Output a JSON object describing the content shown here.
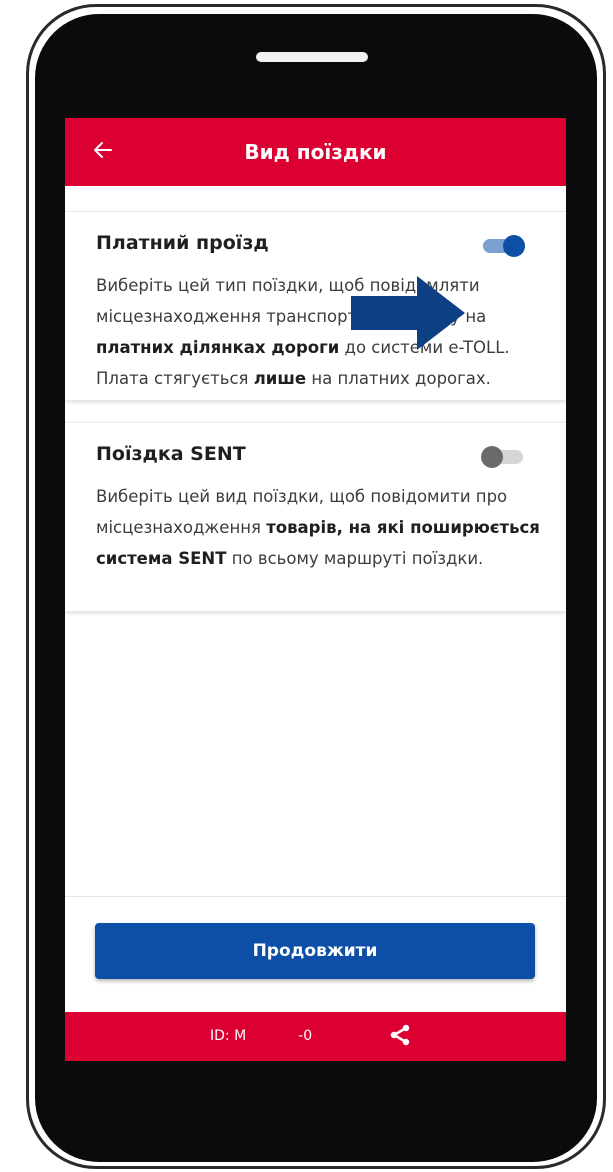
{
  "header": {
    "title": "Вид поїздки"
  },
  "cards": [
    {
      "title": "Платний проїзд",
      "toggle": true,
      "desc_parts": [
        {
          "text": "Виберіть цей тип поїздки, щоб повідомляти місцезнаходження транспортного засобу на ",
          "bold": false
        },
        {
          "text": "платних ділянках дороги",
          "bold": true
        },
        {
          "text": " до системи e-TOLL. Плата стягується ",
          "bold": false
        },
        {
          "text": "лише",
          "bold": true
        },
        {
          "text": " на платних дорогах.",
          "bold": false
        }
      ]
    },
    {
      "title": "Поїздка SENT",
      "toggle": false,
      "desc_parts": [
        {
          "text": "Виберіть цей вид поїздки, щоб повідомити про місцезнаходження ",
          "bold": false
        },
        {
          "text": "товарів, на які поширюється система SENT",
          "bold": true
        },
        {
          "text": " по всьому маршруті поїздки.",
          "bold": false
        }
      ]
    }
  ],
  "footer": {
    "button_label": "Продовжити"
  },
  "bottom_bar": {
    "id_prefix": "ID: M",
    "id_suffix": "-0"
  },
  "icons": {
    "back": "arrow-left-icon",
    "share": "share-icon",
    "annotation": "arrow-right-icon"
  },
  "colors": {
    "brand_red": "#dc0032",
    "primary_blue": "#0d4fa6",
    "annotation_arrow": "#0d3f85",
    "toggle_off": "#6a6a6a"
  }
}
